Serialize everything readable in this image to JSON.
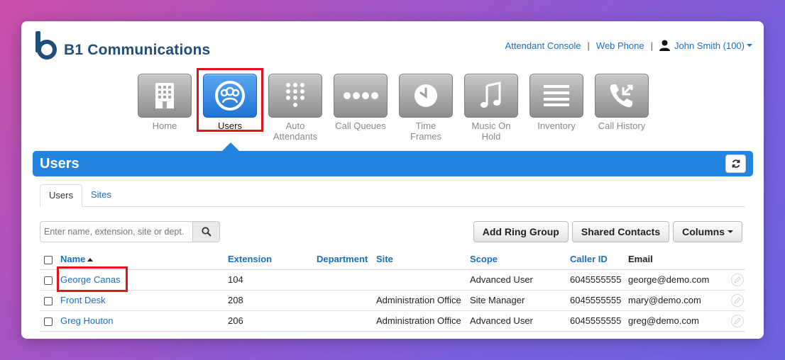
{
  "brand": {
    "name": "B1 Communications",
    "color": "#1f4e7a"
  },
  "topnav": {
    "attendant_console": "Attendant Console",
    "separator": "|",
    "web_phone": "Web Phone",
    "user": "John Smith (100)"
  },
  "tiles": [
    {
      "label": "Home",
      "icon": "building-icon",
      "active": false
    },
    {
      "label": "Users",
      "icon": "users-icon",
      "active": true
    },
    {
      "label": "Auto Attendants",
      "icon": "keypad-icon",
      "active": false
    },
    {
      "label": "Call Queues",
      "icon": "dots-icon",
      "active": false
    },
    {
      "label": "Time Frames",
      "icon": "clock-icon",
      "active": false
    },
    {
      "label": "Music On Hold",
      "icon": "music-note-icon",
      "active": false
    },
    {
      "label": "Inventory",
      "icon": "list-icon",
      "active": false
    },
    {
      "label": "Call History",
      "icon": "phone-arrows-icon",
      "active": false
    }
  ],
  "header": {
    "title": "Users",
    "accent": "#2384e0"
  },
  "tabs": [
    {
      "label": "Users",
      "active": true
    },
    {
      "label": "Sites",
      "active": false
    }
  ],
  "search": {
    "placeholder": "Enter name, extension, site or dept."
  },
  "actions": {
    "add_ring_group": "Add Ring Group",
    "shared_contacts": "Shared Contacts",
    "columns": "Columns"
  },
  "table": {
    "columns": {
      "name": "Name",
      "extension": "Extension",
      "department": "Department",
      "site": "Site",
      "scope": "Scope",
      "caller_id": "Caller ID",
      "email": "Email"
    },
    "rows": [
      {
        "name": "George Canas",
        "extension": "104",
        "department": "",
        "site": "",
        "scope": "Advanced User",
        "caller_id": "6045555555",
        "email": "george@demo.com"
      },
      {
        "name": "Front Desk",
        "extension": "208",
        "department": "",
        "site": "Administration Office",
        "scope": "Site Manager",
        "caller_id": "6045555555",
        "email": "mary@demo.com"
      },
      {
        "name": "Greg Houton",
        "extension": "206",
        "department": "",
        "site": "Administration Office",
        "scope": "Advanced User",
        "caller_id": "6045555555",
        "email": "greg@demo.com"
      }
    ]
  }
}
